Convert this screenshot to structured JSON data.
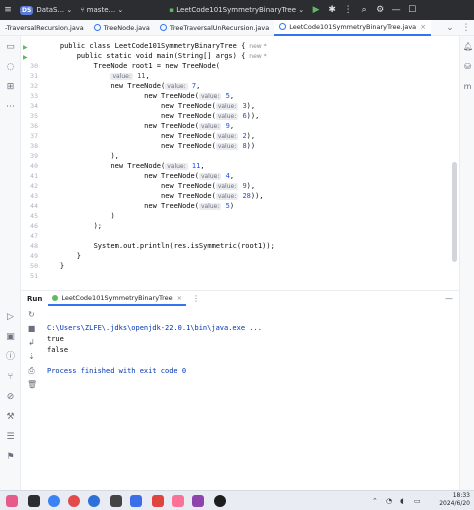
{
  "titlebar": {
    "project_badge": "DS",
    "project_name": "DataS...",
    "branch": "maste...",
    "run_config": "LeetCode101SymmetryBinaryTree"
  },
  "tabs": [
    {
      "label": "-TraversalRecursion.java",
      "active": false
    },
    {
      "label": "TreeNode.java",
      "active": false
    },
    {
      "label": "TreeTraversalUnRecursion.java",
      "active": false
    },
    {
      "label": "LeetCode101SymmetryBinaryTree.java",
      "active": true
    }
  ],
  "editor": {
    "line_numbers": [
      "",
      "",
      "30",
      "31",
      "32",
      "33",
      "34",
      "35",
      "36",
      "37",
      "38",
      "39",
      "40",
      "41",
      "42",
      "43",
      "44",
      "45",
      "46",
      "47",
      "48",
      "49",
      "50",
      "51"
    ],
    "class_decl": "public class LeetCode101SymmetryBinaryTree {",
    "class_usages": "new *",
    "main_decl": "public static void main(String[] args) {",
    "main_usages": "new *",
    "lines": {
      "l30": "TreeNode root1 = new TreeNode(",
      "l31_val": "11",
      "l32": "new TreeNode(",
      "l32_val": "7",
      "l33": "new TreeNode(",
      "l33_val": "5",
      "l34": "new TreeNode(",
      "l34_val": "3",
      "l35": "new TreeNode(",
      "l35_val": "6",
      "l36": "new TreeNode(",
      "l36_val": "9",
      "l37": "new TreeNode(",
      "l37_val": "2",
      "l38": "new TreeNode(",
      "l38_val": "8",
      "l39": "),",
      "l40": "new TreeNode(",
      "l40_val": "11",
      "l41": "new TreeNode(",
      "l41_val": "4",
      "l42": "new TreeNode(",
      "l42_val": "9",
      "l43": "new TreeNode(",
      "l43_val": "28",
      "l44": "new TreeNode(",
      "l44_val": "5",
      "l45": ")",
      "l46": ");",
      "l48": "System.out.println(res.isSymmetric(root1));",
      "l49": "}",
      "l50": "}"
    },
    "hint_label": "value:"
  },
  "run_panel": {
    "title": "Run",
    "tab_label": "LeetCode101SymmetryBinaryTree",
    "console": [
      "C:\\Users\\ZLFE\\.jdks\\openjdk-22.0.1\\bin\\java.exe ...",
      "true",
      "false",
      "",
      "Process finished with exit code 0"
    ]
  },
  "taskbar": {
    "time": "18:33",
    "date": "2024/6/20"
  }
}
